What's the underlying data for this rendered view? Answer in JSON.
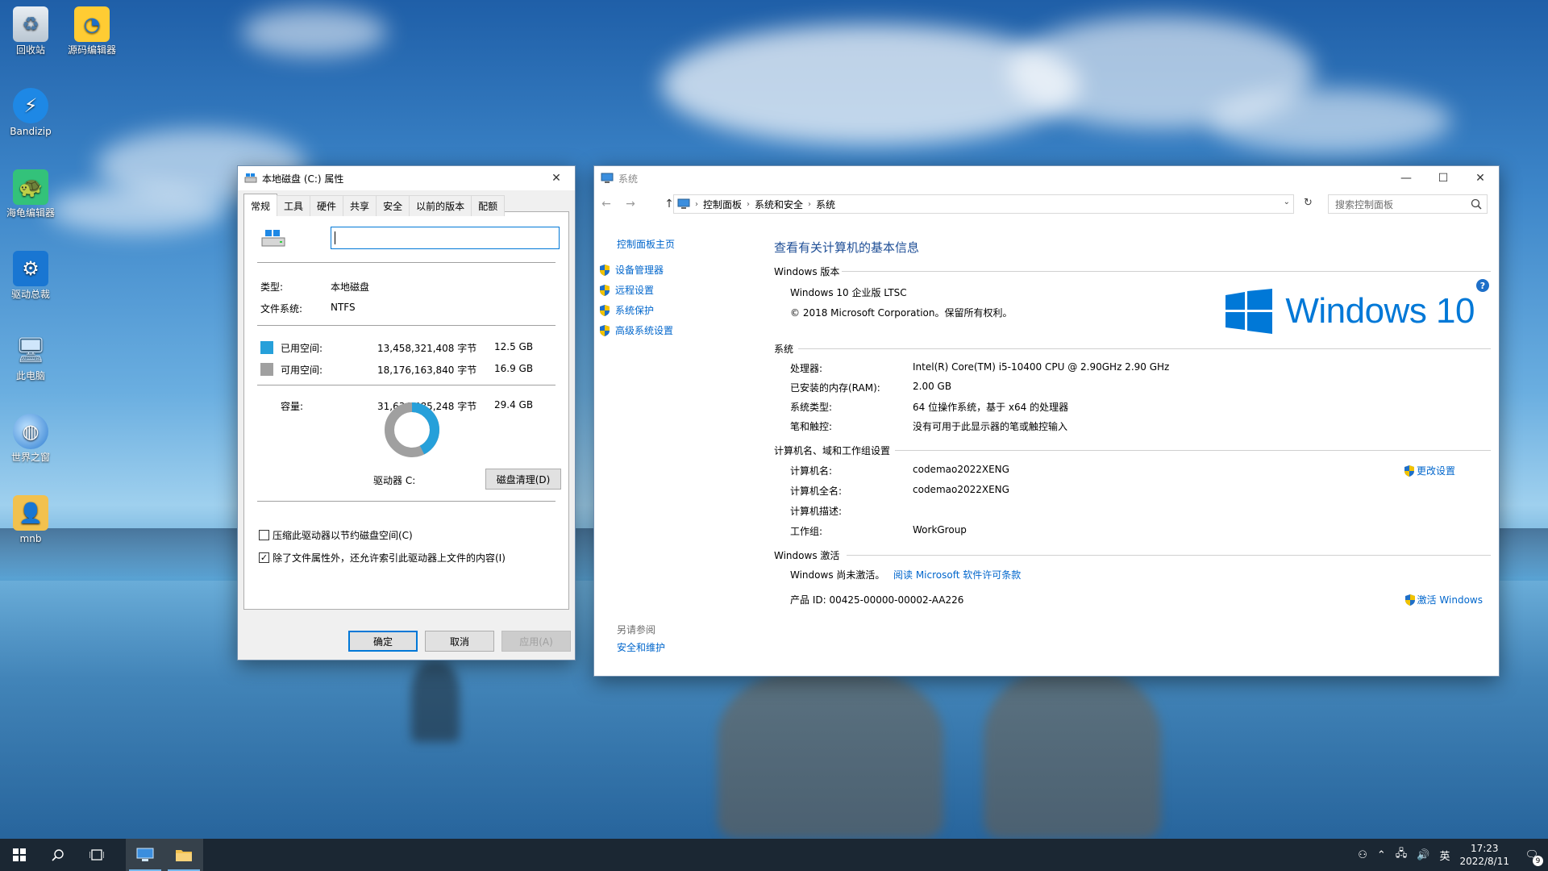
{
  "desktop": {
    "icons": [
      {
        "label": "回收站"
      },
      {
        "label": "源码编辑器"
      },
      {
        "label": "Bandizip"
      },
      {
        "label": "海龟编辑器"
      },
      {
        "label": "驱动总裁"
      },
      {
        "label": "此电脑"
      },
      {
        "label": "世界之窗"
      },
      {
        "label": "mnb"
      }
    ]
  },
  "props_dialog": {
    "title": "本地磁盘 (C:) 属性",
    "tabs": [
      "常规",
      "工具",
      "硬件",
      "共享",
      "安全",
      "以前的版本",
      "配额"
    ],
    "active_tab": "常规",
    "name_input_value": "",
    "type_label": "类型:",
    "type_value": "本地磁盘",
    "fs_label": "文件系统:",
    "fs_value": "NTFS",
    "used_label": "已用空间:",
    "used_bytes": "13,458,321,408 字节",
    "used_gb": "12.5 GB",
    "free_label": "可用空间:",
    "free_bytes": "18,176,163,840 字节",
    "free_gb": "16.9 GB",
    "capacity_label": "容量:",
    "capacity_bytes": "31,634,485,248 字节",
    "capacity_gb": "29.4 GB",
    "used_fraction": 0.4254,
    "used_color": "#26a0da",
    "free_color": "#a0a0a0",
    "drive_label": "驱动器 C:",
    "cleanup_button": "磁盘清理(D)",
    "compress_label": "压缩此驱动器以节约磁盘空间(C)",
    "compress_checked": false,
    "index_label": "除了文件属性外，还允许索引此驱动器上文件的内容(I)",
    "index_checked": true,
    "ok_button": "确定",
    "cancel_button": "取消",
    "apply_button": "应用(A)"
  },
  "system_window": {
    "title": "系统",
    "breadcrumb": [
      "控制面板",
      "系统和安全",
      "系统"
    ],
    "search_placeholder": "搜索控制面板",
    "left_nav": {
      "home": "控制面板主页",
      "items": [
        "设备管理器",
        "远程设置",
        "系统保护",
        "高级系统设置"
      ],
      "see_also": "另请参阅",
      "see_also_link": "安全和维护"
    },
    "main_title": "查看有关计算机的基本信息",
    "edition_section": "Windows 版本",
    "edition_name": "Windows 10 企业版 LTSC",
    "copyright": "© 2018 Microsoft Corporation。保留所有权利。",
    "logo_text": "Windows 10",
    "system_section": "系统",
    "processor_label": "处理器:",
    "processor_value": "Intel(R) Core(TM) i5-10400 CPU @ 2.90GHz   2.90 GHz",
    "ram_label": "已安装的内存(RAM):",
    "ram_value": "2.00 GB",
    "systype_label": "系统类型:",
    "systype_value": "64 位操作系统，基于 x64 的处理器",
    "pen_label": "笔和触控:",
    "pen_value": "没有可用于此显示器的笔或触控输入",
    "computer_section": "计算机名、域和工作组设置",
    "computer_name_label": "计算机名:",
    "computer_name_value": "codemao2022XENG",
    "full_name_label": "计算机全名:",
    "full_name_value": "codemao2022XENG",
    "desc_label": "计算机描述:",
    "desc_value": "",
    "workgroup_label": "工作组:",
    "workgroup_value": "WorkGroup",
    "change_settings": "更改设置",
    "activation_section": "Windows 激活",
    "activation_status": "Windows 尚未激活。",
    "license_link": "阅读 Microsoft 软件许可条款",
    "product_id": "产品 ID: 00425-00000-00002-AA226",
    "activate_link": "激活 Windows"
  },
  "taskbar": {
    "ime": "英",
    "time": "17:23",
    "date": "2022/8/11",
    "notification_count": "9"
  }
}
